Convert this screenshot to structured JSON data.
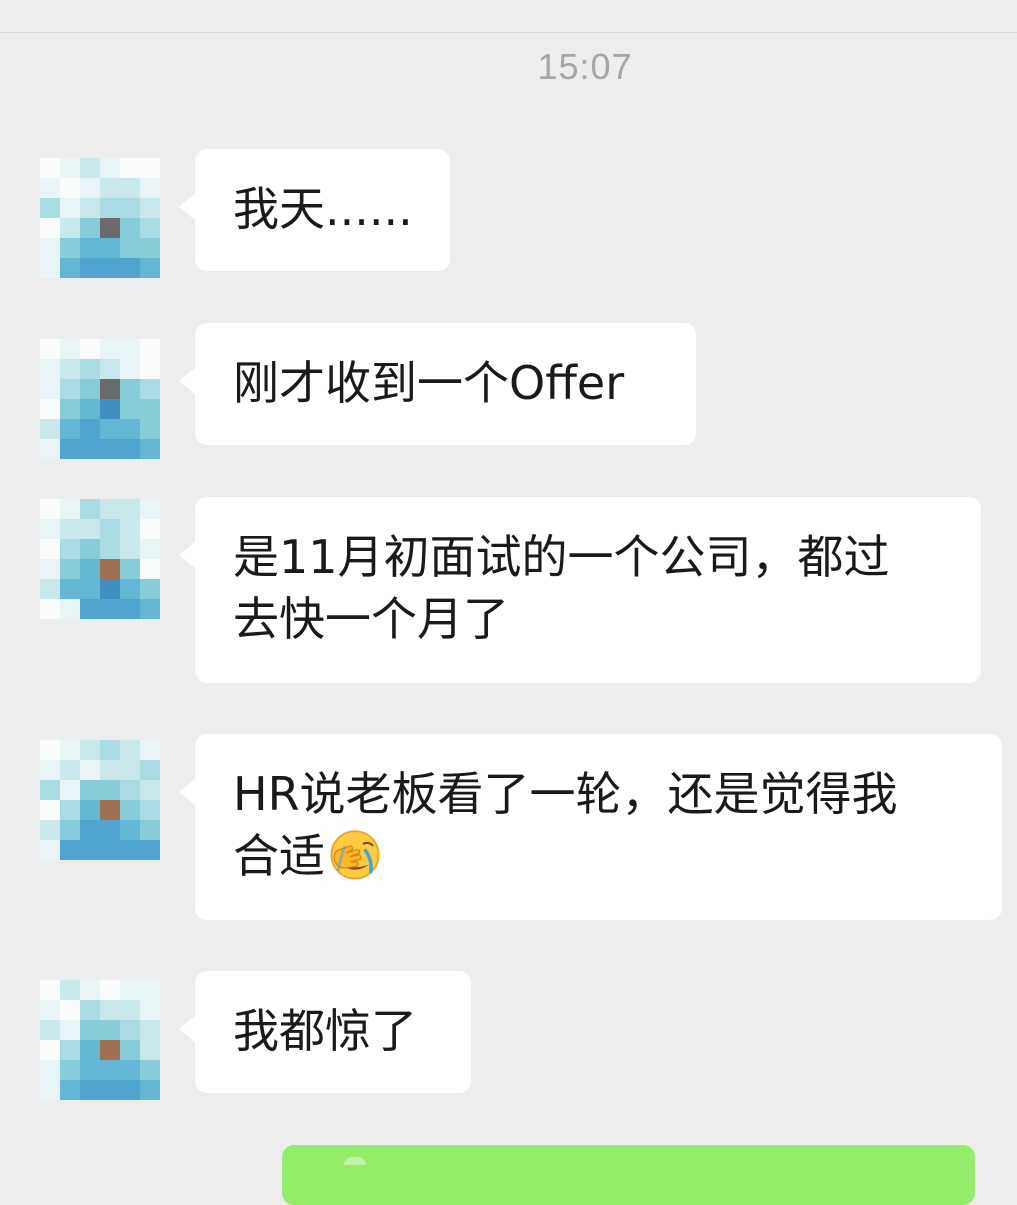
{
  "chat": {
    "timestamp": "15:07",
    "messages": [
      {
        "sender": "contact",
        "text": "我天......",
        "lines": [
          "我天......"
        ]
      },
      {
        "sender": "contact",
        "text": "刚才收到一个Offer",
        "lines": [
          "刚才收到一个Offer"
        ]
      },
      {
        "sender": "contact",
        "text": "是11月初面试的一个公司，都过去快一个月了",
        "lines": [
          "是11月初面试的一个公司，都过",
          "去快一个月了"
        ]
      },
      {
        "sender": "contact",
        "text": "HR说老板看了一轮，还是觉得我合适",
        "lines": [
          "HR说老板看了一轮，还是觉得我",
          "合适"
        ],
        "emoji": "facepalm-emoji"
      },
      {
        "sender": "contact",
        "text": "我都惊了",
        "lines": [
          "我都惊了"
        ]
      },
      {
        "sender": "self",
        "text": ""
      }
    ]
  },
  "colors": {
    "background": "#ededed",
    "incoming_bubble": "#ffffff",
    "outgoing_bubble": "#95ec69",
    "timestamp": "#a6a6a6"
  },
  "avatar": {
    "style": "pixelated-mosaic",
    "palette": [
      "#fafcfc",
      "#e8f4f5",
      "#c9e8ec",
      "#a9dde3",
      "#86ccd9",
      "#63b7d4",
      "#4fa5cf",
      "#3f8fc0",
      "#6b6b6b",
      "#a07050"
    ]
  }
}
